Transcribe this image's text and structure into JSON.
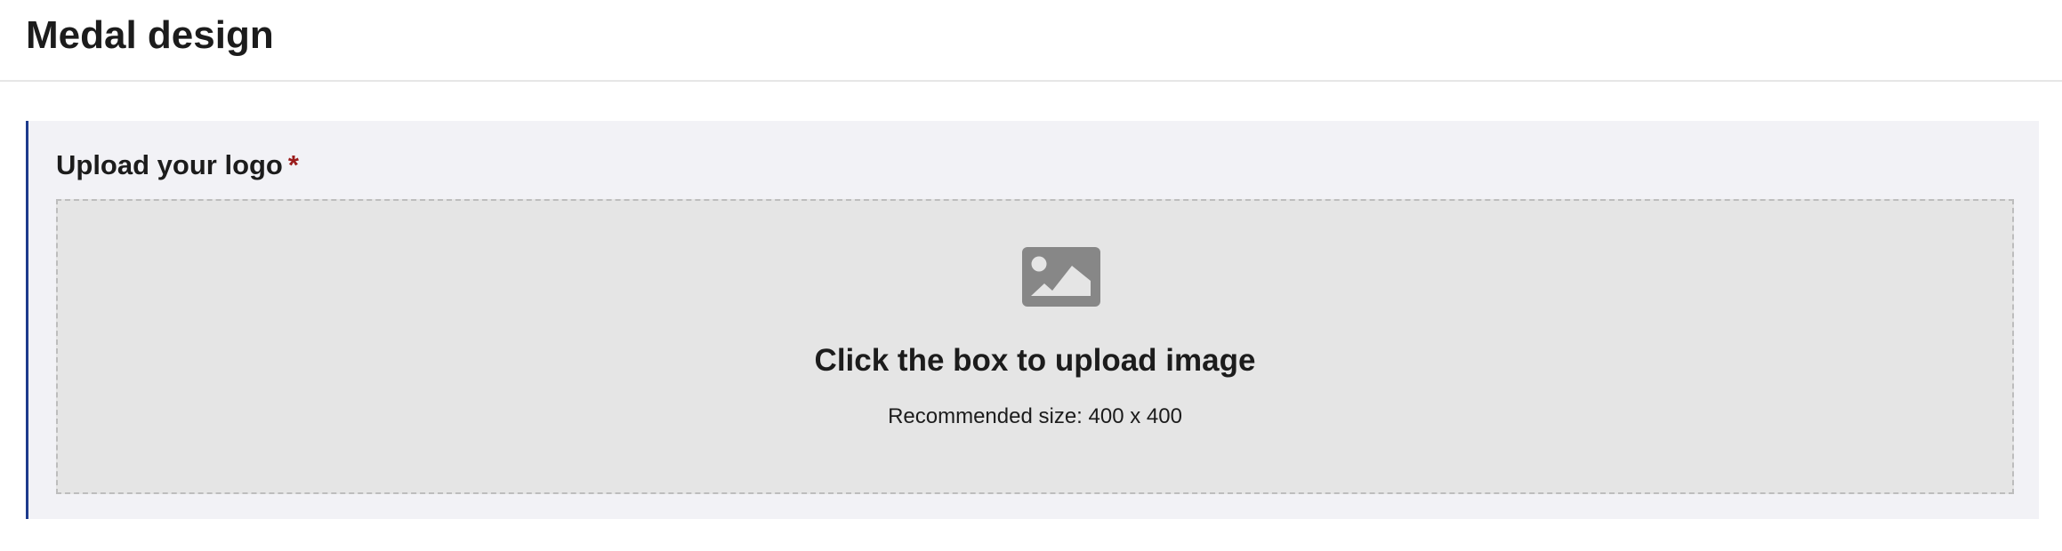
{
  "header": {
    "title": "Medal design"
  },
  "logo_section": {
    "label": "Upload your logo",
    "required_mark": "*",
    "dropzone": {
      "icon": "image-icon",
      "title": "Click the box to upload image",
      "hint": "Recommended size: 400 x 400"
    }
  },
  "colors": {
    "accent_border": "#1d3b8c",
    "required": "#9b1c1c",
    "section_background": "#f2f2f6",
    "dropzone_background": "#e5e5e5",
    "icon": "#878787"
  }
}
